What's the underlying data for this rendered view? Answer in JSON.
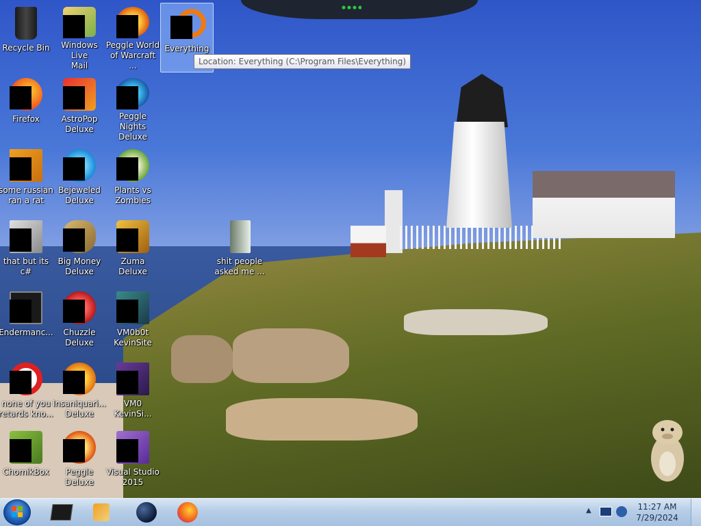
{
  "tooltip": {
    "text": "Location: Everything (C:\\Program Files\\Everything)"
  },
  "desktop": {
    "icons": [
      {
        "label": "Recycle Bin",
        "icon": "recycle-bin-icon"
      },
      {
        "label": "Windows Live\nMail",
        "icon": "mail-icon"
      },
      {
        "label": "Peggle World\nof Warcraft ...",
        "icon": "peggle-icon"
      },
      {
        "label": "Everything",
        "icon": "search-app-icon"
      },
      {
        "label": "Firefox",
        "icon": "firefox-icon"
      },
      {
        "label": "AstroPop\nDeluxe",
        "icon": "astropop-icon"
      },
      {
        "label": "Peggle Nights\nDeluxe",
        "icon": "peggle-nights-icon"
      },
      {
        "label": "some russian\nran a rat",
        "icon": "image-file-icon"
      },
      {
        "label": "Bejeweled\nDeluxe",
        "icon": "bejeweled-icon"
      },
      {
        "label": "Plants vs\nZombies",
        "icon": "plants-vs-zombies-icon"
      },
      {
        "label": "that but its c#",
        "icon": "copy-stack-icon"
      },
      {
        "label": "Big Money\nDeluxe",
        "icon": "money-bag-icon"
      },
      {
        "label": "Zuma Deluxe",
        "icon": "zuma-icon"
      },
      {
        "label": "shit people\nasked me ...",
        "icon": "folder-icon"
      },
      {
        "label": "Endermanc...",
        "icon": "terminal-icon"
      },
      {
        "label": "Chuzzle\nDeluxe",
        "icon": "chuzzle-icon"
      },
      {
        "label": "VM0b0t\nKevinSite",
        "icon": "vm-icon"
      },
      {
        "label": "none of you\nretards kno...",
        "icon": "opera-icon"
      },
      {
        "label": "Insaniquari...\nDeluxe",
        "icon": "fish-icon"
      },
      {
        "label": "VM0\nKevinSi...",
        "icon": "vm-icon"
      },
      {
        "label": "ChomikBox",
        "icon": "chomikbox-icon"
      },
      {
        "label": "Peggle Deluxe",
        "icon": "peggle-icon"
      },
      {
        "label": "Visual Studio\n2015",
        "icon": "visual-studio-icon"
      }
    ]
  },
  "taskbar": {
    "pinned": [
      {
        "icon": "terminal-icon"
      },
      {
        "icon": "media-player-icon"
      },
      {
        "icon": "globe-icon"
      },
      {
        "icon": "firefox-icon"
      }
    ],
    "clock": {
      "time": "11:27 AM",
      "date": "7/29/2024"
    }
  },
  "colors": {
    "taskbar": "#b6cde6",
    "selection": "#96beff",
    "sky": "#2f56c8"
  }
}
